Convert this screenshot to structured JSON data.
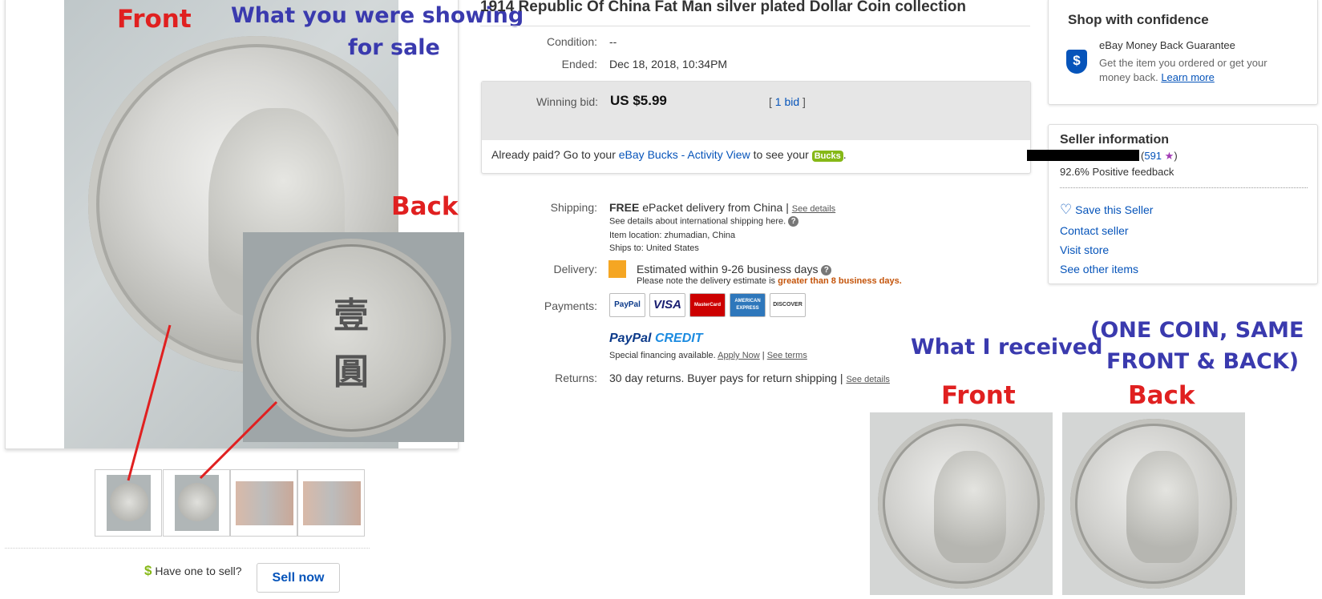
{
  "listing": {
    "title": "1914 Republic Of China Fat Man silver plated Dollar Coin collection",
    "condition_label": "Condition:",
    "condition_value": "--",
    "ended_label": "Ended:",
    "ended_value": "Dec 18, 2018, 10:34PM",
    "winning_bid_label": "Winning bid:",
    "winning_bid_value": "US $5.99",
    "bids_open": "[",
    "bids_link": "1 bid",
    "bids_close": "]",
    "paid_prefix": "Already paid? Go to your",
    "paid_link": "eBay Bucks - Activity View",
    "paid_suffix": "to see your",
    "bucks_badge": "Bucks",
    "paid_end": "."
  },
  "shipping": {
    "label": "Shipping:",
    "free": "FREE",
    "method": "ePacket delivery from China |",
    "see_details": "See details",
    "intl_note": "See details about international shipping here.",
    "help": "?",
    "item_location": "Item location:  zhumadian, China",
    "ships_to": "Ships to:  United States"
  },
  "delivery": {
    "label": "Delivery:",
    "estimate": "Estimated within 9-26 business days",
    "note_prefix": "Please note the delivery estimate is",
    "note_highlight": "greater than 8 business days."
  },
  "payments": {
    "label": "Payments:",
    "cards": [
      "PayPal",
      "VISA",
      "MasterCard",
      "AMERICAN EXPRESS",
      "DISCOVER"
    ],
    "credit_logo_1": "PayPal",
    "credit_logo_2": "CREDIT",
    "financing": "Special financing available.",
    "apply_now": "Apply Now",
    "sep": "|",
    "see_terms": "See terms"
  },
  "returns": {
    "label": "Returns:",
    "value": "30 day returns. Buyer pays for return shipping |",
    "see_details": "See details"
  },
  "confidence": {
    "heading": "Shop with confidence",
    "guarantee_title": "eBay Money Back Guarantee",
    "guarantee_text_1": "Get the item you ordered or get your",
    "guarantee_text_2": "money back.",
    "learn_more": "Learn more",
    "shield_glyph": "$"
  },
  "seller": {
    "heading": "Seller information",
    "feedback_open": "(",
    "feedback_count": "591",
    "feedback_close": ")",
    "positive": "92.6% Positive feedback",
    "save": "Save this Seller",
    "contact": "Contact seller",
    "store": "Visit store",
    "other": "See other items"
  },
  "sell": {
    "prompt": "Have one to sell?",
    "button": "Sell now",
    "dollar": "$"
  },
  "annotations": {
    "front": "Front",
    "back": "Back",
    "showing_1": "What you were showing",
    "showing_2": "for sale",
    "received": "What I received",
    "one_coin_1": "(ONE COIN, SAME",
    "one_coin_2": "FRONT & BACK)",
    "recv_front": "Front",
    "recv_back": "Back"
  },
  "coin_chars": {
    "top": "壹",
    "bottom": "圓"
  },
  "colors": {
    "link": "#0654ba",
    "annotation_red": "#e02020",
    "annotation_blue": "#3a3aae",
    "bucks_green": "#86b817",
    "delivery_highlight": "#c4540a"
  },
  "icons": [
    "heart-icon",
    "star-icon",
    "shield-icon",
    "flag-icon",
    "help-icon",
    "dollar-icon"
  ]
}
